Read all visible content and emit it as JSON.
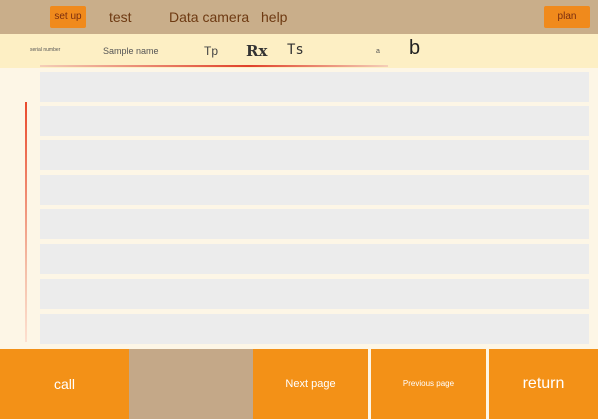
{
  "menu": {
    "setup": "set up",
    "test": "test",
    "data_camera": "Data camera",
    "help": "help",
    "plan": "plan"
  },
  "columns": {
    "serial_number": "serial number",
    "sample_name": "Sample name",
    "tp": "Tp",
    "rx": "Rx",
    "ts": "Ts",
    "a": "a",
    "b": "b"
  },
  "rows": [
    "",
    "",
    "",
    "",
    "",
    "",
    "",
    ""
  ],
  "buttons": {
    "call": "call",
    "blank": "",
    "next_page": "Next page",
    "previous_page": "Previous page",
    "return": "return"
  },
  "colors": {
    "menubar": "#c9ae8a",
    "accent_orange": "#f39117",
    "header_bg": "#fdefc4",
    "row_bg": "#ececec",
    "accent_red": "#e0412a"
  }
}
